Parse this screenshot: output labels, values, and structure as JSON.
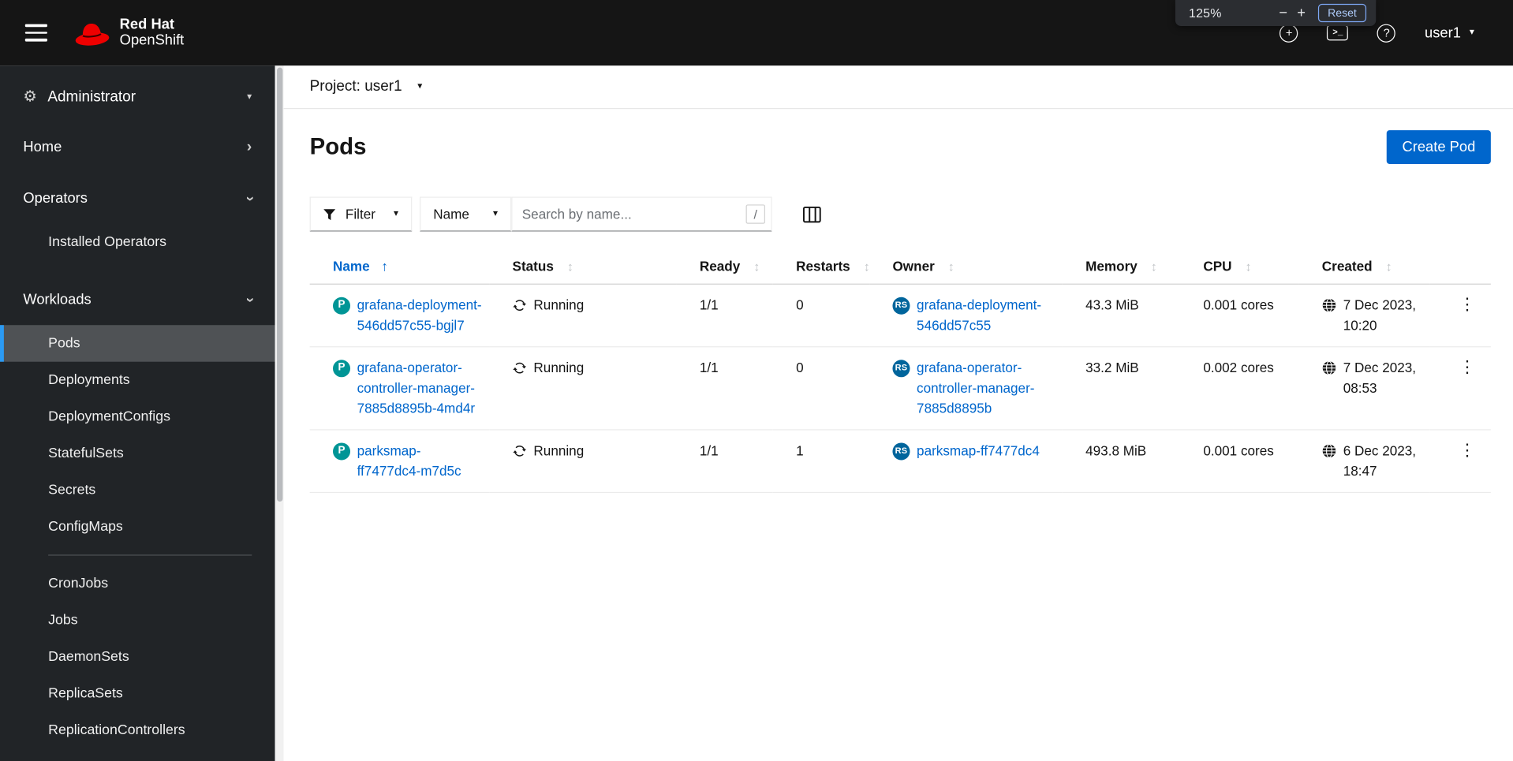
{
  "masthead": {
    "brand_line1": "Red Hat",
    "brand_line2": "OpenShift",
    "user": "user1"
  },
  "zoom_popup": {
    "level": "125%",
    "minus": "−",
    "plus": "+",
    "reset": "Reset"
  },
  "icons": {
    "caret_down": "▾",
    "chevron": "›",
    "gear": "⚙",
    "help": "?",
    "plus": "+",
    "terminal": ">_",
    "kebab": "⋮",
    "sort": "↕",
    "sort_ascending": "↑"
  },
  "sidebar": {
    "perspective": "Administrator",
    "sections": {
      "home": "Home",
      "operators": "Operators",
      "workloads": "Workloads"
    },
    "operators_items": [
      "Installed Operators"
    ],
    "workloads_items_top": [
      "Pods",
      "Deployments",
      "DeploymentConfigs",
      "StatefulSets",
      "Secrets",
      "ConfigMaps"
    ],
    "workloads_items_bottom": [
      "CronJobs",
      "Jobs",
      "DaemonSets",
      "ReplicaSets",
      "ReplicationControllers"
    ],
    "active_item": "Pods"
  },
  "project_bar": {
    "label": "Project: user1"
  },
  "page": {
    "title": "Pods",
    "create_button": "Create Pod"
  },
  "toolbar": {
    "filter_label": "Filter",
    "attribute_label": "Name",
    "search_placeholder": "Search by name...",
    "shortcut_hint": "/"
  },
  "table": {
    "columns": [
      "Name",
      "Status",
      "Ready",
      "Restarts",
      "Owner",
      "Memory",
      "CPU",
      "Created"
    ],
    "sort": {
      "column": "Name",
      "direction": "ascending"
    },
    "rows": [
      {
        "badge": "P",
        "name": "grafana-deployment-546dd57c55-bgjl7",
        "status": "Running",
        "ready": "1/1",
        "restarts": "0",
        "owner_badge": "RS",
        "owner": "grafana-deployment-546dd57c55",
        "memory": "43.3 MiB",
        "cpu": "0.001 cores",
        "created": "7 Dec 2023, 10:20"
      },
      {
        "badge": "P",
        "name": "grafana-operator-controller-manager-7885d8895b-4md4r",
        "status": "Running",
        "ready": "1/1",
        "restarts": "0",
        "owner_badge": "RS",
        "owner": "grafana-operator-controller-manager-7885d8895b",
        "memory": "33.2 MiB",
        "cpu": "0.002 cores",
        "created": "7 Dec 2023, 08:53"
      },
      {
        "badge": "P",
        "name": "parksmap-ff7477dc4-m7d5c",
        "status": "Running",
        "ready": "1/1",
        "restarts": "1",
        "owner_badge": "RS",
        "owner": "parksmap-ff7477dc4",
        "memory": "493.8 MiB",
        "cpu": "0.001 cores",
        "created": "6 Dec 2023, 18:47"
      }
    ]
  },
  "colors": {
    "link_blue": "#0066cc",
    "primary_button": "#0066cc",
    "pod_badge": "#009596",
    "replicaset_badge": "#00659c",
    "nav_active_indicator": "#2b9af3",
    "masthead_bg": "#151515",
    "sidebar_bg": "#212427"
  }
}
